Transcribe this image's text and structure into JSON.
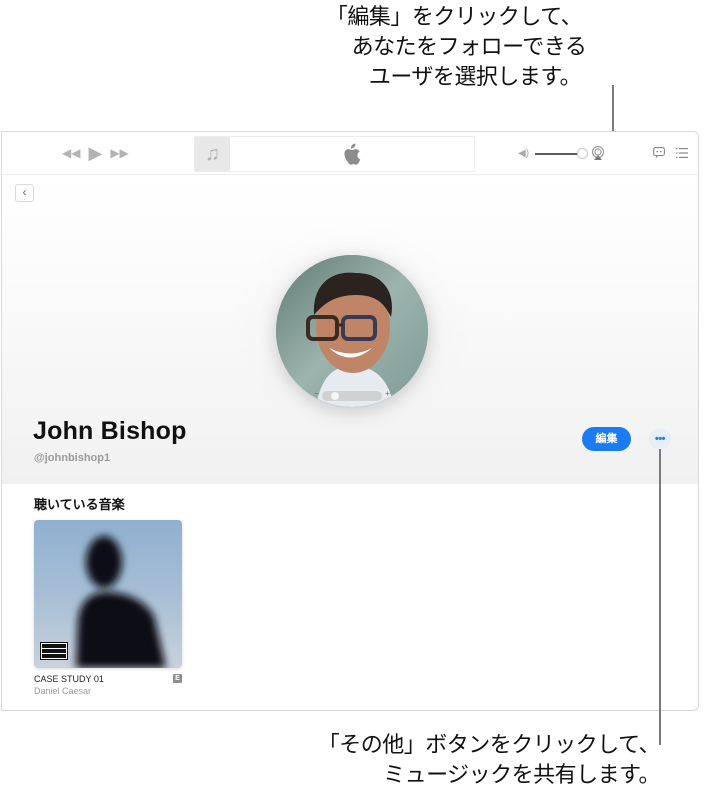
{
  "callouts": {
    "top": {
      "line1": "「編集」をクリックして、",
      "line2": "あなたをフォローできる",
      "line3": "ユーザを選択します。"
    },
    "bottom": {
      "line1": "「その他」ボタンをクリックして、",
      "line2": "ミュージックを共有します。"
    }
  },
  "toolbar": {
    "icons": {
      "rewind": "rewind-icon",
      "play": "play-icon",
      "fast_forward": "fast-forward-icon",
      "now_playing_art": "music-note-icon",
      "logo": "apple-logo-icon",
      "volume": "speaker-icon",
      "airplay": "airplay-icon",
      "lyrics": "lyrics-bubble-icon",
      "queue": "list-icon"
    },
    "glyphs": {
      "rewind": "◀◀",
      "play": "▶",
      "fast_forward": "▶▶",
      "music_note": "♫",
      "volume": "◀)"
    },
    "volume_level": 1.0
  },
  "profile": {
    "back_glyph": "‹",
    "name": "John Bishop",
    "handle": "@johnbishop1",
    "edit_label": "編集",
    "more_label": "•••",
    "photo_zoom": {
      "minus": "−",
      "plus": "+",
      "level": 0.15
    }
  },
  "listening": {
    "title": "聴いている音楽",
    "albums": [
      {
        "title": "CASE STUDY 01",
        "artist": "Daniel Caesar",
        "explicit_badge": "E",
        "parental_advisory": true
      }
    ]
  },
  "colors": {
    "accent": "#1a7bf2",
    "more_bg": "#e8eef6",
    "secondary_text": "#9a9a9a"
  }
}
